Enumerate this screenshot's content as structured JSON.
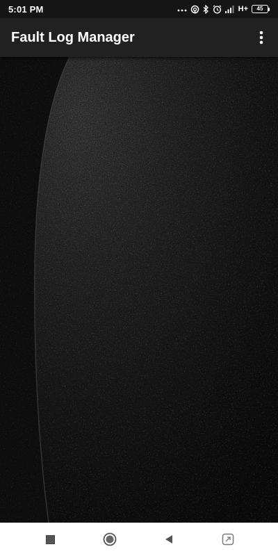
{
  "status_bar": {
    "time": "5:01 PM",
    "network_type": "H+",
    "battery_level": "45",
    "icons": [
      "more-dots-icon",
      "hotspot-icon",
      "bluetooth-icon",
      "alarm-icon",
      "signal-icon",
      "battery-icon"
    ]
  },
  "app_bar": {
    "title": "Fault Log Manager",
    "overflow_icon": "more-vert-icon"
  },
  "content": {
    "background": "textured-dark-planet-image"
  },
  "nav_bar": {
    "icons": [
      "recent-apps-icon",
      "home-icon",
      "back-icon",
      "assistant-icon"
    ]
  },
  "colors": {
    "status_bar_bg": "#151515",
    "app_bar_bg": "#212121",
    "content_bg": "#0a0a0a",
    "nav_bar_bg": "#ffffff",
    "text_primary": "#ffffff"
  }
}
